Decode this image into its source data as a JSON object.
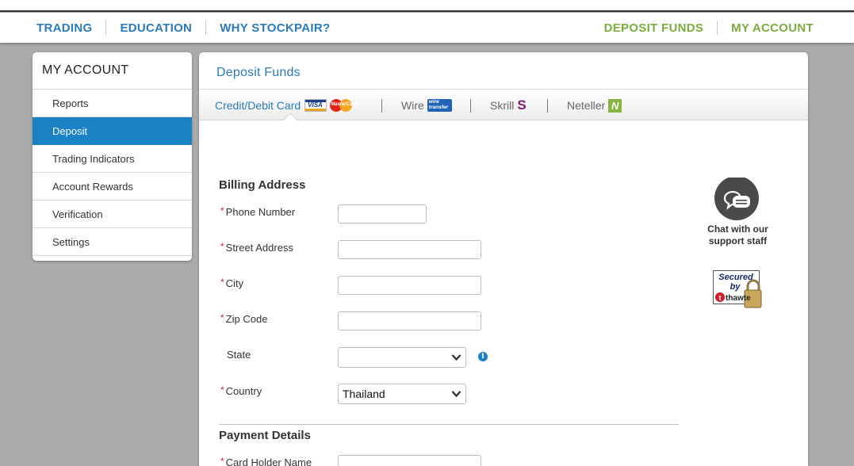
{
  "topnav": {
    "left": [
      "TRADING",
      "EDUCATION",
      "WHY STOCKPAIR?"
    ],
    "right": [
      "DEPOSIT FUNDS",
      "MY ACCOUNT"
    ]
  },
  "sidebar": {
    "title": "MY ACCOUNT",
    "items": [
      {
        "label": "Reports"
      },
      {
        "label": "Deposit"
      },
      {
        "label": "Trading Indicators"
      },
      {
        "label": "Account Rewards"
      },
      {
        "label": "Verification"
      },
      {
        "label": "Settings"
      }
    ]
  },
  "panel": {
    "title": "Deposit Funds",
    "tabs": [
      {
        "label": "Credit/Debit Card",
        "badge": "VISA",
        "badge2": "MasterCard"
      },
      {
        "label": "Wire",
        "badge": "wire transfer"
      },
      {
        "label": "Skrill",
        "badge": "S"
      },
      {
        "label": "Neteller",
        "badge": "N"
      }
    ]
  },
  "billing": {
    "title": "Billing Address",
    "required_mark": "*",
    "phone_label": "Phone Number",
    "phone_value": "",
    "street_label": "Street Address",
    "street_value": "",
    "city_label": "City",
    "city_value": "",
    "zip_label": "Zip Code",
    "zip_value": "",
    "state_label": "State",
    "state_value": "",
    "country_label": "Country",
    "country_value": "Thailand",
    "info_glyph": "i"
  },
  "payment": {
    "title": "Payment Details",
    "holder_label": "Card Holder Name",
    "holder_value": ""
  },
  "support": {
    "chat_text": "Chat with our support staff",
    "secured_line1": "Secured",
    "secured_line2": "by",
    "secured_line3": "thawte"
  },
  "colors": {
    "brand_blue": "#2a7ab8",
    "accent_green": "#7bab3d",
    "active_blue": "#1b82c5",
    "required_red": "#c0282d"
  }
}
